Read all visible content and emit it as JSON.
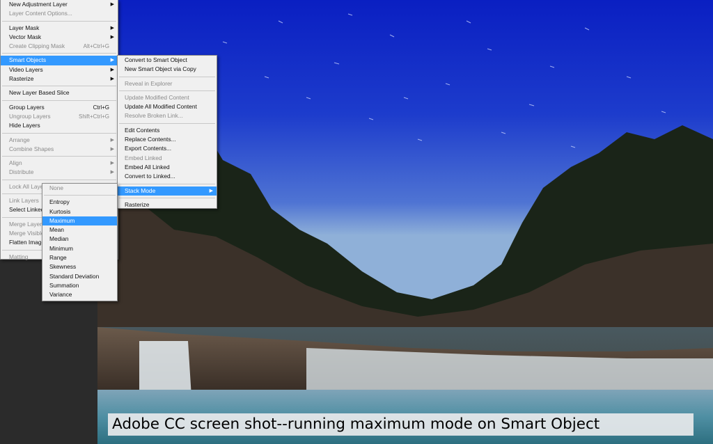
{
  "layer_menu": {
    "items": [
      {
        "label": "New Adjustment Layer",
        "shortcut": "",
        "submenu": true,
        "disabled": false
      },
      {
        "label": "Layer Content Options...",
        "shortcut": "",
        "submenu": false,
        "disabled": true
      },
      {
        "sep": true
      },
      {
        "label": "Layer Mask",
        "shortcut": "",
        "submenu": true,
        "disabled": false
      },
      {
        "label": "Vector Mask",
        "shortcut": "",
        "submenu": true,
        "disabled": false
      },
      {
        "label": "Create Clipping Mask",
        "shortcut": "Alt+Ctrl+G",
        "submenu": false,
        "disabled": true
      },
      {
        "sep": true
      },
      {
        "label": "Smart Objects",
        "shortcut": "",
        "submenu": true,
        "disabled": false,
        "active": true
      },
      {
        "label": "Video Layers",
        "shortcut": "",
        "submenu": true,
        "disabled": false
      },
      {
        "label": "Rasterize",
        "shortcut": "",
        "submenu": true,
        "disabled": false
      },
      {
        "sep": true
      },
      {
        "label": "New Layer Based Slice",
        "shortcut": "",
        "submenu": false,
        "disabled": false
      },
      {
        "sep": true
      },
      {
        "label": "Group Layers",
        "shortcut": "Ctrl+G",
        "submenu": false,
        "disabled": false
      },
      {
        "label": "Ungroup Layers",
        "shortcut": "Shift+Ctrl+G",
        "submenu": false,
        "disabled": true
      },
      {
        "label": "Hide Layers",
        "shortcut": "",
        "submenu": false,
        "disabled": false
      },
      {
        "sep": true
      },
      {
        "label": "Arrange",
        "shortcut": "",
        "submenu": true,
        "disabled": true
      },
      {
        "label": "Combine Shapes",
        "shortcut": "",
        "submenu": true,
        "disabled": true
      },
      {
        "sep": true
      },
      {
        "label": "Align",
        "shortcut": "",
        "submenu": true,
        "disabled": true
      },
      {
        "label": "Distribute",
        "shortcut": "",
        "submenu": true,
        "disabled": true
      },
      {
        "sep": true
      },
      {
        "label": "Lock All Layers in Group...",
        "shortcut": "",
        "submenu": false,
        "disabled": true
      },
      {
        "sep": true
      },
      {
        "label": "Link Layers",
        "shortcut": "",
        "submenu": false,
        "disabled": true
      },
      {
        "label": "Select Linked Layers",
        "shortcut": "",
        "submenu": false,
        "disabled": false
      },
      {
        "sep": true
      },
      {
        "label": "Merge Layers",
        "shortcut": "",
        "submenu": false,
        "disabled": true
      },
      {
        "label": "Merge Visible",
        "shortcut": "",
        "submenu": false,
        "disabled": true
      },
      {
        "label": "Flatten Image",
        "shortcut": "",
        "submenu": false,
        "disabled": false
      },
      {
        "sep": true
      },
      {
        "label": "Matting",
        "shortcut": "",
        "submenu": true,
        "disabled": true
      }
    ]
  },
  "smart_objects_menu": {
    "items": [
      {
        "label": "Convert to Smart Object",
        "submenu": false,
        "disabled": false
      },
      {
        "label": "New Smart Object via Copy",
        "submenu": false,
        "disabled": false
      },
      {
        "sep": true
      },
      {
        "label": "Reveal in Explorer",
        "submenu": false,
        "disabled": true
      },
      {
        "sep": true
      },
      {
        "label": "Update Modified Content",
        "submenu": false,
        "disabled": true
      },
      {
        "label": "Update All Modified Content",
        "submenu": false,
        "disabled": false
      },
      {
        "label": "Resolve Broken Link...",
        "submenu": false,
        "disabled": true
      },
      {
        "sep": true
      },
      {
        "label": "Edit Contents",
        "submenu": false,
        "disabled": false
      },
      {
        "label": "Replace Contents...",
        "submenu": false,
        "disabled": false
      },
      {
        "label": "Export Contents...",
        "submenu": false,
        "disabled": false
      },
      {
        "label": "Embed Linked",
        "submenu": false,
        "disabled": true
      },
      {
        "label": "Embed All Linked",
        "submenu": false,
        "disabled": false
      },
      {
        "label": "Convert to Linked...",
        "submenu": false,
        "disabled": false
      },
      {
        "sep": true
      },
      {
        "label": "Stack Mode",
        "submenu": true,
        "disabled": false,
        "active": true
      },
      {
        "sep": true
      },
      {
        "label": "Rasterize",
        "submenu": false,
        "disabled": false
      }
    ]
  },
  "stack_mode_menu": {
    "items": [
      {
        "label": "None",
        "disabled": true
      },
      {
        "sep": true
      },
      {
        "label": "Entropy",
        "disabled": false
      },
      {
        "label": "Kurtosis",
        "disabled": false
      },
      {
        "label": "Maximum",
        "disabled": false,
        "active": true
      },
      {
        "label": "Mean",
        "disabled": false
      },
      {
        "label": "Median",
        "disabled": false
      },
      {
        "label": "Minimum",
        "disabled": false
      },
      {
        "label": "Range",
        "disabled": false
      },
      {
        "label": "Skewness",
        "disabled": false
      },
      {
        "label": "Standard Deviation",
        "disabled": false
      },
      {
        "label": "Summation",
        "disabled": false
      },
      {
        "label": "Variance",
        "disabled": false
      }
    ]
  },
  "caption": "Adobe CC screen shot--running maximum mode on Smart Object",
  "colors": {
    "menu_bg": "#f0f0f0",
    "highlight": "#3399ff",
    "disabled_text": "#8a8a8a",
    "sky_top": "#0c23c8"
  }
}
